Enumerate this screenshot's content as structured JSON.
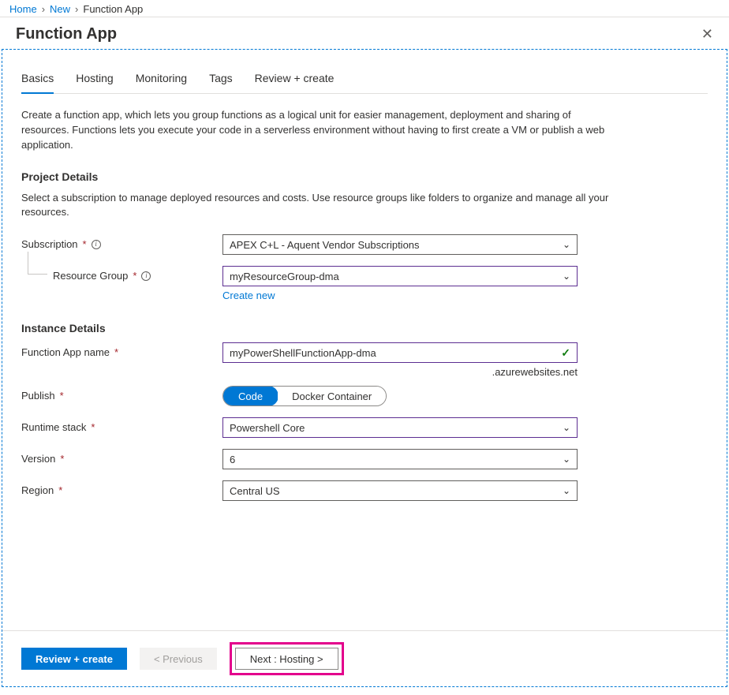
{
  "breadcrumb": {
    "home": "Home",
    "new": "New",
    "current": "Function App"
  },
  "header": {
    "title": "Function App"
  },
  "tabs": {
    "basics": "Basics",
    "hosting": "Hosting",
    "monitoring": "Monitoring",
    "tags": "Tags",
    "review": "Review + create"
  },
  "intro": "Create a function app, which lets you group functions as a logical unit for easier management, deployment and sharing of resources. Functions lets you execute your code in a serverless environment without having to first create a VM or publish a web application.",
  "project": {
    "heading": "Project Details",
    "desc": "Select a subscription to manage deployed resources and costs. Use resource groups like folders to organize and manage all your resources.",
    "subscription_label": "Subscription",
    "subscription_value": "APEX C+L - Aquent Vendor Subscriptions",
    "rg_label": "Resource Group",
    "rg_value": "myResourceGroup-dma",
    "create_new": "Create new"
  },
  "instance": {
    "heading": "Instance Details",
    "name_label": "Function App name",
    "name_value": "myPowerShellFunctionApp-dma",
    "suffix": ".azurewebsites.net",
    "publish_label": "Publish",
    "publish_code": "Code",
    "publish_docker": "Docker Container",
    "runtime_label": "Runtime stack",
    "runtime_value": "Powershell Core",
    "version_label": "Version",
    "version_value": "6",
    "region_label": "Region",
    "region_value": "Central US"
  },
  "footer": {
    "review": "Review + create",
    "previous": "< Previous",
    "next": "Next : Hosting >"
  }
}
